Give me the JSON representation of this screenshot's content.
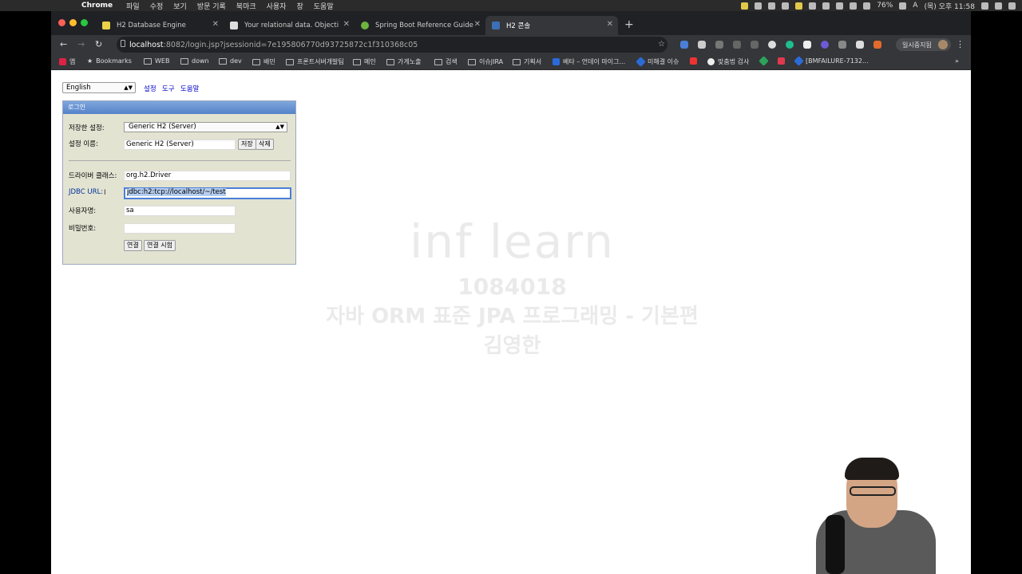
{
  "menubar": {
    "app": "Chrome",
    "items": [
      "파일",
      "수정",
      "보기",
      "방문 기록",
      "북마크",
      "사용자",
      "창",
      "도움말"
    ],
    "battery": "76%",
    "clock": "(목) 오후 11:58",
    "input_source": "A"
  },
  "tabs": [
    {
      "title": "H2 Database Engine"
    },
    {
      "title": "Your relational data. Objective"
    },
    {
      "title": "Spring Boot Reference Guide"
    },
    {
      "title": "H2 콘솔"
    }
  ],
  "address": {
    "host": "localhost",
    "path": ":8082/login.jsp?jsessionid=7e195806770d93725872c1f310368c05"
  },
  "profile": {
    "label": "일시중지됨"
  },
  "bookmarks": [
    {
      "label": "앱"
    },
    {
      "label": "Bookmarks"
    },
    {
      "label": "WEB"
    },
    {
      "label": "down"
    },
    {
      "label": "dev"
    },
    {
      "label": "배민"
    },
    {
      "label": "프론트서버개발팀"
    },
    {
      "label": "메인"
    },
    {
      "label": "가게노출"
    },
    {
      "label": "검색"
    },
    {
      "label": "이슈JIRA"
    },
    {
      "label": "기획서"
    },
    {
      "label": "베타 – 언데이 마이그..."
    },
    {
      "label": "미해결 이슈"
    },
    {
      "label": "맞춤법 검사"
    },
    {
      "label": "[BMFAILURE-7132..."
    }
  ],
  "page": {
    "language": "English",
    "links": [
      "설정",
      "도구",
      "도움말"
    ],
    "panel_title": "로그인",
    "saved_settings_label": "저장한 설정:",
    "saved_settings_value": "Generic H2 (Server)",
    "setting_name_label": "설정 이름:",
    "setting_name_value": "Generic H2 (Server)",
    "save_button": "저장",
    "delete_button": "삭제",
    "driver_class_label": "드라이버 클래스:",
    "driver_class_value": "org.h2.Driver",
    "jdbc_url_label": "JDBC URL:",
    "jdbc_url_value": "jdbc:h2:tcp://localhost/~/test",
    "username_label": "사용자명:",
    "username_value": "sa",
    "password_label": "비밀번호:",
    "password_value": "",
    "connect_button": "연결",
    "test_connection_button": "연결 시험"
  },
  "watermark": {
    "logo": "inf learn",
    "id": "1084018",
    "course": "자바 ORM 표준 JPA 프로그래밍 - 기본편",
    "author": "김영한"
  }
}
